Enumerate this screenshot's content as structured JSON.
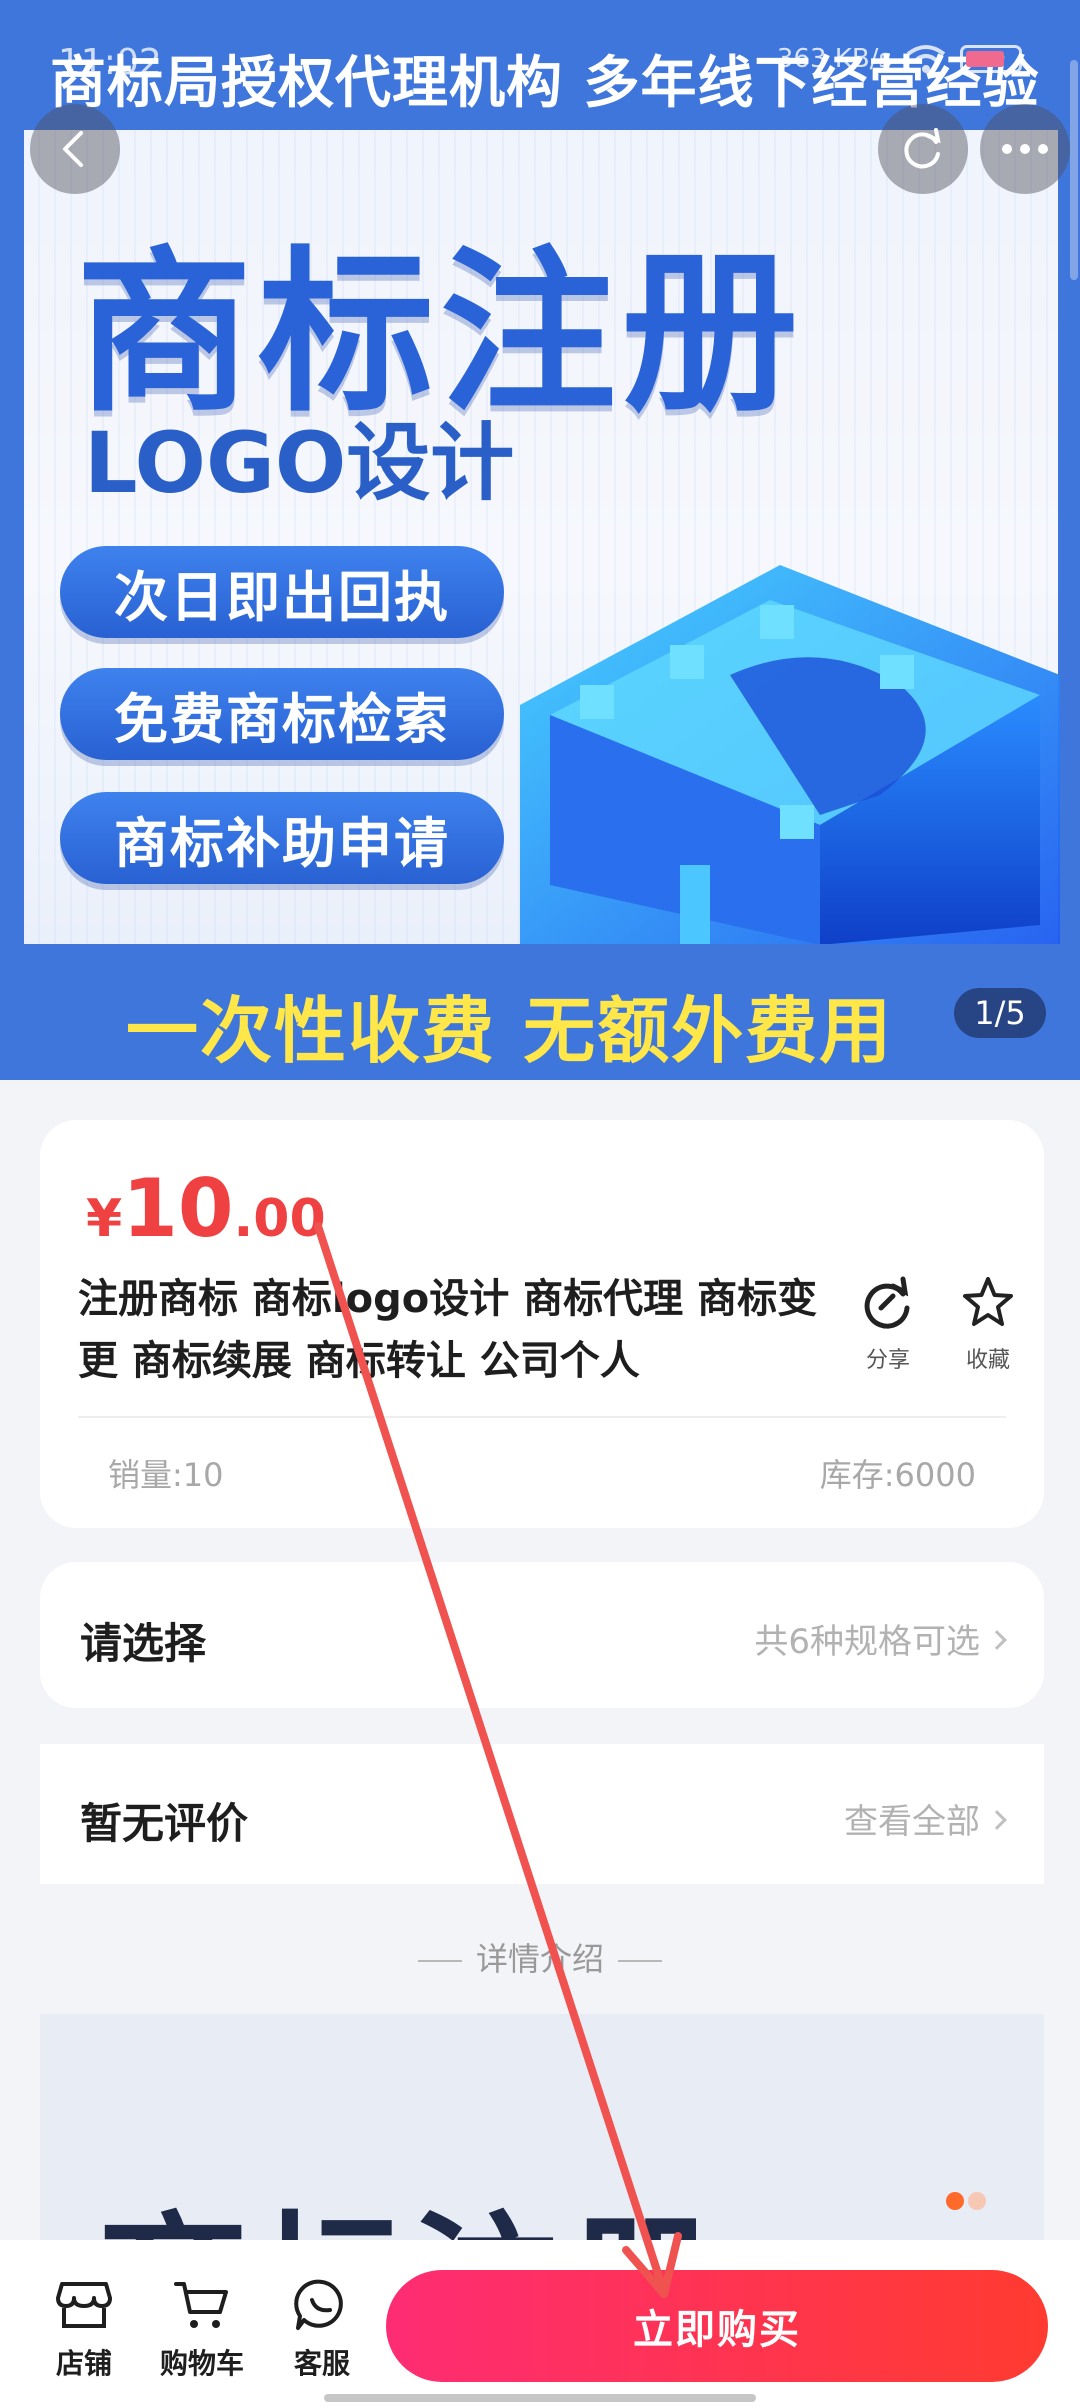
{
  "status_bar": {
    "time": "11:02",
    "network": "363 KB/s"
  },
  "hero": {
    "top_text": "商标局授权代理机构  多年线下经营经验",
    "title": "商标注册",
    "subtitle": "LOGO设计",
    "pills": [
      "次日即出回执",
      "免费商标检索",
      "商标补助申请"
    ],
    "bottom_text": "一次性收费  无额外费用",
    "page_indicator": "1/5"
  },
  "product": {
    "price_symbol": "¥",
    "price_integer": "10",
    "price_decimal": ".00",
    "title": "注册商标 商标logo设计 商标代理 商标变更 商标续展 商标转让 公司个人",
    "share_label": "分享",
    "favorite_label": "收藏",
    "sales": "销量:10",
    "stock": "库存:6000"
  },
  "spec": {
    "label": "请选择",
    "hint": "共6种规格可选"
  },
  "reviews": {
    "label": "暂无评价",
    "hint": "查看全部"
  },
  "detail": {
    "section_title": "详情介绍",
    "preview_title": "商标注册"
  },
  "bottom_bar": {
    "tabs": [
      "店铺",
      "购物车",
      "客服"
    ],
    "buy_label": "立即购买"
  },
  "colors": {
    "accent": "#f04142",
    "hero_blue": "#3f76dc",
    "buy_gradient_start": "#fe2c74",
    "buy_gradient_end": "#ff3b30",
    "annotation": "#f0524f"
  }
}
